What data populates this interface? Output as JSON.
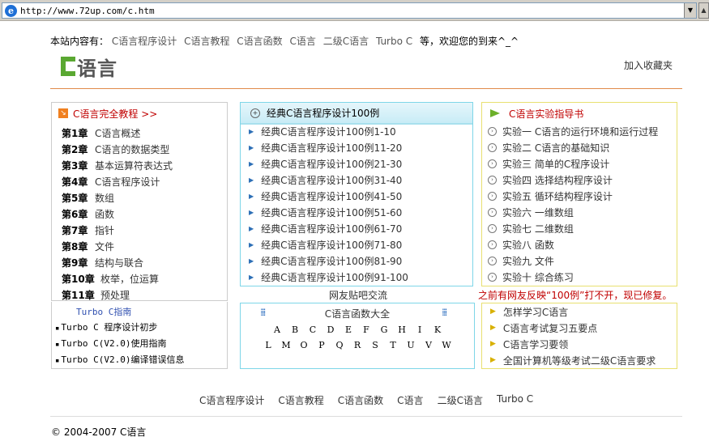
{
  "browser": {
    "url": "http://www.72up.com/c.htm",
    "icon": "ie-icon"
  },
  "intro": {
    "prefix": "本站内容有：",
    "topics": [
      "C语言程序设计",
      "C语言教程",
      "C语言函数",
      "C语言",
      "二级C语言",
      "Turbo C"
    ],
    "suffix": "等，欢迎您的到来^_^"
  },
  "header": {
    "logo_text": "语言",
    "favorite": "加入收藏夹",
    "line_color": "#e08a4a"
  },
  "tutorial": {
    "title": "C语言完全教程 >>",
    "chapters": [
      {
        "num": "第1章",
        "title": "C语言概述"
      },
      {
        "num": "第2章",
        "title": "C语言的数据类型"
      },
      {
        "num": "第3章",
        "title": "基本运算符表达式"
      },
      {
        "num": "第4章",
        "title": "C语言程序设计"
      },
      {
        "num": "第5章",
        "title": "数组"
      },
      {
        "num": "第6章",
        "title": "函数"
      },
      {
        "num": "第7章",
        "title": "指针"
      },
      {
        "num": "第8章",
        "title": "文件"
      },
      {
        "num": "第9章",
        "title": "结构与联合"
      },
      {
        "num": "第10章",
        "title": "枚举，位运算"
      },
      {
        "num": "第11章",
        "title": "预处理"
      }
    ]
  },
  "turbo": {
    "title": "Turbo C指南",
    "items": [
      "Turbo C 程序设计初步",
      "Turbo C(V2.0)使用指南",
      "Turbo C(V2.0)编译错误信息"
    ]
  },
  "examples": {
    "title": "经典C语言程序设计100例",
    "items": [
      "经典C语言程序设计100例1-10",
      "经典C语言程序设计100例11-20",
      "经典C语言程序设计100例21-30",
      "经典C语言程序设计100例31-40",
      "经典C语言程序设计100例41-50",
      "经典C语言程序设计100例51-60",
      "经典C语言程序设计100例61-70",
      "经典C语言程序设计100例71-80",
      "经典C语言程序设计100例81-90",
      "经典C语言程序设计100例91-100"
    ],
    "forum": "网友贴吧交流"
  },
  "functions": {
    "title": "C语言函数大全",
    "row1": [
      "A",
      "B",
      "C",
      "D",
      "E",
      "F",
      "G",
      "H",
      "I",
      "K"
    ],
    "row2": [
      "L",
      "M",
      "O",
      "P",
      "Q",
      "R",
      "S",
      "T",
      "U",
      "V",
      "W"
    ]
  },
  "lab": {
    "title": "C语言实验指导书",
    "items": [
      "实验一 C语言的运行环境和运行过程",
      "实验二 C语言的基础知识",
      "实验三 简单的C程序设计",
      "实验四 选择结构程序设计",
      "实验五 循环结构程序设计",
      "实验六 一维数组",
      "实验七 二维数组",
      "实验八 函数",
      "实验九 文件",
      "实验十 综合练习"
    ],
    "notice": "之前有网友反映“100例”打不开，现已修复。"
  },
  "tips": {
    "items": [
      "怎样学习C语言",
      "C语言考试复习五要点",
      "C语言学习要领",
      "全国计算机等级考试二级C语言要求"
    ]
  },
  "footer": {
    "links": [
      "C语言程序设计",
      "C语言教程",
      "C语言函数",
      "C语言",
      "二级C语言",
      "Turbo C"
    ],
    "copyright": "© 2004-2007 C语言"
  }
}
